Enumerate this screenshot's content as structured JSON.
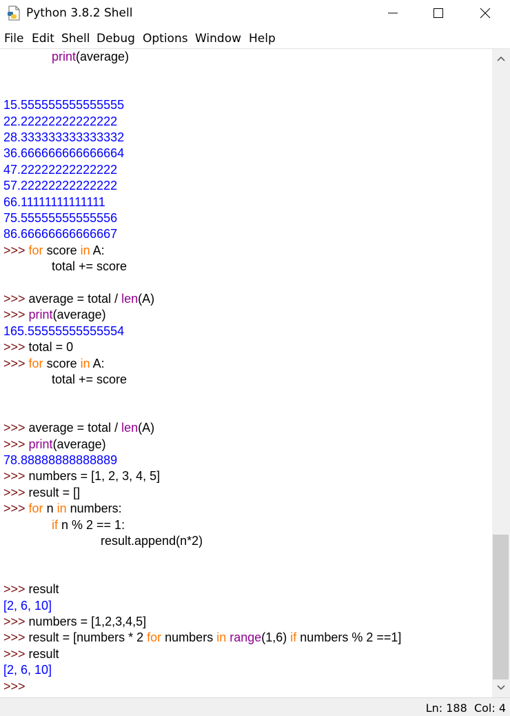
{
  "window": {
    "title": "Python 3.8.2 Shell",
    "icon": "python-idle-icon"
  },
  "menu": [
    "File",
    "Edit",
    "Shell",
    "Debug",
    "Options",
    "Window",
    "Help"
  ],
  "status": {
    "line": "Ln: 188",
    "col": "Col: 4"
  },
  "colors": {
    "prompt": "#7a1010",
    "keyword": "#ff7700",
    "builtin": "#900090",
    "output": "#0000ff"
  },
  "lines": [
    {
      "indent": 1,
      "tokens": [
        {
          "c": "b",
          "t": "print"
        },
        {
          "c": "n",
          "t": "(average)"
        }
      ]
    },
    {
      "indent": 0,
      "tokens": []
    },
    {
      "indent": 0,
      "tokens": []
    },
    {
      "indent": 0,
      "tokens": [
        {
          "c": "o",
          "t": "15.555555555555555"
        }
      ]
    },
    {
      "indent": 0,
      "tokens": [
        {
          "c": "o",
          "t": "22.22222222222222"
        }
      ]
    },
    {
      "indent": 0,
      "tokens": [
        {
          "c": "o",
          "t": "28.333333333333332"
        }
      ]
    },
    {
      "indent": 0,
      "tokens": [
        {
          "c": "o",
          "t": "36.666666666666664"
        }
      ]
    },
    {
      "indent": 0,
      "tokens": [
        {
          "c": "o",
          "t": "47.22222222222222"
        }
      ]
    },
    {
      "indent": 0,
      "tokens": [
        {
          "c": "o",
          "t": "57.22222222222222"
        }
      ]
    },
    {
      "indent": 0,
      "tokens": [
        {
          "c": "o",
          "t": "66.11111111111111"
        }
      ]
    },
    {
      "indent": 0,
      "tokens": [
        {
          "c": "o",
          "t": "75.55555555555556"
        }
      ]
    },
    {
      "indent": 0,
      "tokens": [
        {
          "c": "o",
          "t": "86.66666666666667"
        }
      ]
    },
    {
      "indent": 0,
      "tokens": [
        {
          "c": "p",
          "t": ">>> "
        },
        {
          "c": "k",
          "t": "for"
        },
        {
          "c": "n",
          "t": " score "
        },
        {
          "c": "k",
          "t": "in"
        },
        {
          "c": "n",
          "t": " A:"
        }
      ]
    },
    {
      "indent": 1,
      "tokens": [
        {
          "c": "n",
          "t": "total += score"
        }
      ]
    },
    {
      "indent": 0,
      "tokens": []
    },
    {
      "indent": 0,
      "tokens": [
        {
          "c": "p",
          "t": ">>> "
        },
        {
          "c": "n",
          "t": "average = total / "
        },
        {
          "c": "b",
          "t": "len"
        },
        {
          "c": "n",
          "t": "(A)"
        }
      ]
    },
    {
      "indent": 0,
      "tokens": [
        {
          "c": "p",
          "t": ">>> "
        },
        {
          "c": "b",
          "t": "print"
        },
        {
          "c": "n",
          "t": "(average)"
        }
      ]
    },
    {
      "indent": 0,
      "tokens": [
        {
          "c": "o",
          "t": "165.55555555555554"
        }
      ]
    },
    {
      "indent": 0,
      "tokens": [
        {
          "c": "p",
          "t": ">>> "
        },
        {
          "c": "n",
          "t": "total = 0"
        }
      ]
    },
    {
      "indent": 0,
      "tokens": [
        {
          "c": "p",
          "t": ">>> "
        },
        {
          "c": "k",
          "t": "for"
        },
        {
          "c": "n",
          "t": " score "
        },
        {
          "c": "k",
          "t": "in"
        },
        {
          "c": "n",
          "t": " A:"
        }
      ]
    },
    {
      "indent": 1,
      "tokens": [
        {
          "c": "n",
          "t": "total += score"
        }
      ]
    },
    {
      "indent": 0,
      "tokens": []
    },
    {
      "indent": 0,
      "tokens": []
    },
    {
      "indent": 0,
      "tokens": [
        {
          "c": "p",
          "t": ">>> "
        },
        {
          "c": "n",
          "t": "average = total / "
        },
        {
          "c": "b",
          "t": "len"
        },
        {
          "c": "n",
          "t": "(A)"
        }
      ]
    },
    {
      "indent": 0,
      "tokens": [
        {
          "c": "p",
          "t": ">>> "
        },
        {
          "c": "b",
          "t": "print"
        },
        {
          "c": "n",
          "t": "(average)"
        }
      ]
    },
    {
      "indent": 0,
      "tokens": [
        {
          "c": "o",
          "t": "78.88888888888889"
        }
      ]
    },
    {
      "indent": 0,
      "tokens": [
        {
          "c": "p",
          "t": ">>> "
        },
        {
          "c": "n",
          "t": "numbers = [1, 2, 3, 4, 5]"
        }
      ]
    },
    {
      "indent": 0,
      "tokens": [
        {
          "c": "p",
          "t": ">>> "
        },
        {
          "c": "n",
          "t": "result = []"
        }
      ]
    },
    {
      "indent": 0,
      "tokens": [
        {
          "c": "p",
          "t": ">>> "
        },
        {
          "c": "k",
          "t": "for"
        },
        {
          "c": "n",
          "t": " n "
        },
        {
          "c": "k",
          "t": "in"
        },
        {
          "c": "n",
          "t": " numbers:"
        }
      ]
    },
    {
      "indent": 1,
      "tokens": [
        {
          "c": "k",
          "t": "if"
        },
        {
          "c": "n",
          "t": " n % 2 == 1:"
        }
      ]
    },
    {
      "indent": 2,
      "tokens": [
        {
          "c": "n",
          "t": "result.append(n*2)"
        }
      ]
    },
    {
      "indent": 0,
      "tokens": []
    },
    {
      "indent": 0,
      "tokens": []
    },
    {
      "indent": 0,
      "tokens": [
        {
          "c": "p",
          "t": ">>> "
        },
        {
          "c": "n",
          "t": "result"
        }
      ]
    },
    {
      "indent": 0,
      "tokens": [
        {
          "c": "o",
          "t": "[2, 6, 10]"
        }
      ]
    },
    {
      "indent": 0,
      "tokens": [
        {
          "c": "p",
          "t": ">>> "
        },
        {
          "c": "n",
          "t": "numbers = [1,2,3,4,5]"
        }
      ]
    },
    {
      "indent": 0,
      "tokens": [
        {
          "c": "p",
          "t": ">>> "
        },
        {
          "c": "n",
          "t": "result = [numbers * 2 "
        },
        {
          "c": "k",
          "t": "for"
        },
        {
          "c": "n",
          "t": " numbers "
        },
        {
          "c": "k",
          "t": "in"
        },
        {
          "c": "n",
          "t": " "
        },
        {
          "c": "b",
          "t": "range"
        },
        {
          "c": "n",
          "t": "(1,6) "
        },
        {
          "c": "k",
          "t": "if"
        },
        {
          "c": "n",
          "t": " numbers % 2 ==1]"
        }
      ]
    },
    {
      "indent": 0,
      "tokens": [
        {
          "c": "p",
          "t": ">>> "
        },
        {
          "c": "n",
          "t": "result"
        }
      ]
    },
    {
      "indent": 0,
      "tokens": [
        {
          "c": "o",
          "t": "[2, 6, 10]"
        }
      ]
    },
    {
      "indent": 0,
      "tokens": [
        {
          "c": "p",
          "t": ">>> "
        }
      ]
    }
  ]
}
